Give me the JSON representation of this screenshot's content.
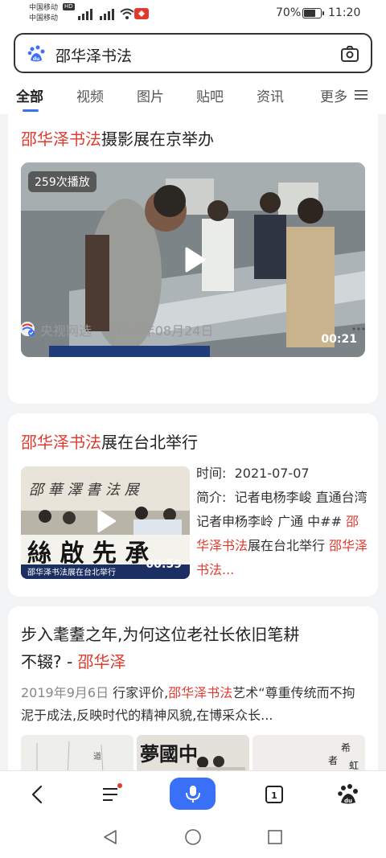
{
  "status_bar": {
    "carrier1": "中国移动",
    "carrier2": "中国移动",
    "hd_badge": "HD",
    "battery_text": "70%",
    "battery_level": 0.7,
    "time": "11:20"
  },
  "search": {
    "query": "邵华泽书法"
  },
  "tabs": [
    {
      "label": "全部"
    },
    {
      "label": "视频"
    },
    {
      "label": "图片"
    },
    {
      "label": "贴吧"
    },
    {
      "label": "资讯"
    },
    {
      "label": "更多"
    }
  ],
  "card1": {
    "title_hl": "邵华泽书法",
    "title_rest": "摄影展在京举办",
    "plays": "259次播放",
    "duration": "00:21",
    "source": "央视网选",
    "date": "2013年08月24日"
  },
  "card2": {
    "title_hl": "邵华泽书法",
    "title_rest": "展在台北举行",
    "duration": "00:59",
    "time_label": "时间:",
    "time_value": "2021-07-07",
    "intro_label": "简介:",
    "intro_text": "记者电杨李峻 直通台湾 记者申杨李岭 广通 中## ",
    "intro_hl1": "邵华泽书法",
    "intro_mid": "展在台北举行 ",
    "intro_hl2": "邵华泽书法..."
  },
  "card3": {
    "title_line1": "步入耄耋之年,为何这位老社长依旧笔耕",
    "title_line2_rest": "不辍? - ",
    "title_line2_hl": "邵华泽",
    "date": "2019年9月6日",
    "desc_a": " 行家评价,",
    "desc_hl": "邵华泽书法",
    "desc_b": "艺术“尊重传统而不拘泥于成法,反映时代的精神风貌,在博采众长..."
  },
  "colors": {
    "accent": "#3a6ff7",
    "highlight": "#e03a2f"
  }
}
